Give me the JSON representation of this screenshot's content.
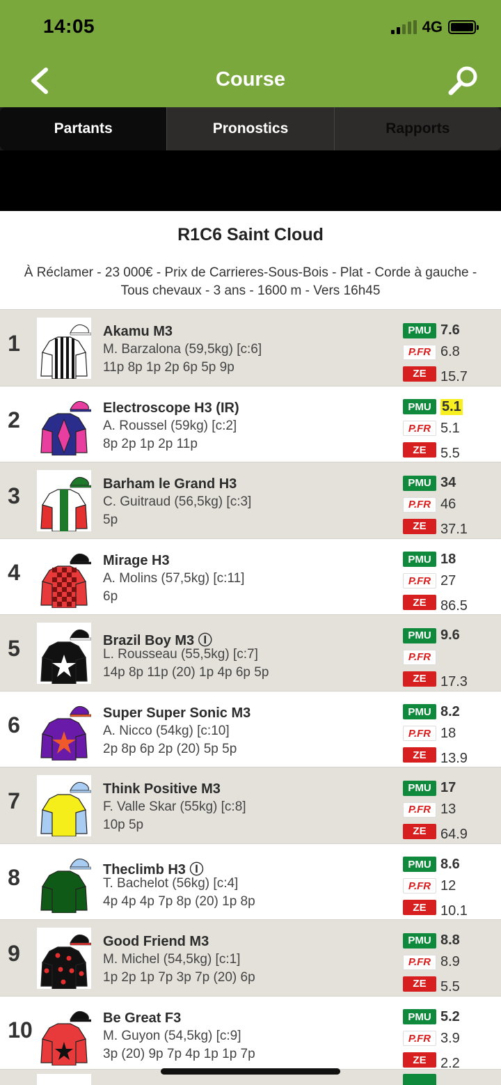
{
  "status": {
    "time": "14:05",
    "network": "4G"
  },
  "nav": {
    "title": "Course",
    "back_icon": "chevron-left-icon",
    "search_icon": "search-icon"
  },
  "tabs": [
    {
      "label": "Partants",
      "active": true
    },
    {
      "label": "Pronostics",
      "active": false
    },
    {
      "label": "Rapports",
      "active": false
    }
  ],
  "race": {
    "title": "R1C6 Saint Cloud",
    "info_line1": "À Réclamer - 23 000€ - Prix de Carrieres-Sous-Bois - Plat - Corde à gauche -",
    "info_line2": "Tous chevaux - 3 ans - 1600 m - Vers 16h45"
  },
  "badges": {
    "pmu": "PMU",
    "pfr": "P.FR",
    "ze": "ZE"
  },
  "colors": {
    "header_green": "#7aa83c",
    "pmu_green": "#0f8a3c",
    "ze_red": "#d71f1f",
    "highlight": "#f7ef1f"
  },
  "runners": [
    {
      "number": "1",
      "name": "Akamu M3",
      "jockey": "M. Barzalona (59,5kg) [c:6]",
      "form": "11p 8p 1p 2p 6p 5p 9p",
      "pmu": "7.6",
      "pfr": "6.8",
      "ze": "15.7",
      "highlight": false,
      "silk": "white-black-stripes"
    },
    {
      "number": "2",
      "name": "Electroscope H3 (IR)",
      "jockey": "A. Roussel (59kg) [c:2]",
      "form": "8p 2p 1p 2p 11p",
      "pmu": "5.1",
      "pfr": "5.1",
      "ze": "5.5",
      "highlight": true,
      "silk": "navy-pink-diamond"
    },
    {
      "number": "3",
      "name": "Barham le Grand H3",
      "jockey": "C. Guitraud (56,5kg) [c:3]",
      "form": "5p",
      "pmu": "34",
      "pfr": "46",
      "ze": "37.1",
      "highlight": false,
      "silk": "white-green-red-sleeves"
    },
    {
      "number": "4",
      "name": "Mirage H3",
      "jockey": "A. Molins (57,5kg) [c:11]",
      "form": "6p",
      "pmu": "18",
      "pfr": "27",
      "ze": "86.5",
      "highlight": false,
      "silk": "red-checks"
    },
    {
      "number": "5",
      "name": "Brazil Boy M3 Ⓘ",
      "jockey": "L. Rousseau (55,5kg) [c:7]",
      "form": "14p 8p 11p (20) 1p 4p 6p 5p",
      "pmu": "9.6",
      "pfr": "",
      "ze": "17.3",
      "highlight": false,
      "silk": "black-white-star"
    },
    {
      "number": "6",
      "name": "Super Super Sonic M3",
      "jockey": "A. Nicco (54kg) [c:10]",
      "form": "2p 8p 6p 2p (20) 5p 5p",
      "pmu": "8.2",
      "pfr": "18",
      "ze": "13.9",
      "highlight": false,
      "silk": "purple-orange-star"
    },
    {
      "number": "7",
      "name": "Think Positive M3",
      "jockey": "F. Valle Skar (55kg) [c:8]",
      "form": "10p 5p",
      "pmu": "17",
      "pfr": "13",
      "ze": "64.9",
      "highlight": false,
      "silk": "yellow-lightblue-sleeves"
    },
    {
      "number": "8",
      "name": "Theclimb H3 Ⓘ",
      "jockey": "T. Bachelot (56kg) [c:4]",
      "form": "4p 4p 4p 7p 8p (20) 1p 8p",
      "pmu": "8.6",
      "pfr": "12",
      "ze": "10.1",
      "highlight": false,
      "silk": "dark-green"
    },
    {
      "number": "9",
      "name": "Good Friend M3",
      "jockey": "M. Michel (54,5kg) [c:1]",
      "form": "1p 2p 1p 7p 3p 7p (20) 6p",
      "pmu": "8.8",
      "pfr": "8.9",
      "ze": "5.5",
      "highlight": false,
      "silk": "black-red-stars"
    },
    {
      "number": "10",
      "name": "Be Great F3",
      "jockey": "M. Guyon (54,5kg) [c:9]",
      "form": "3p (20) 9p 7p 4p 1p 1p 7p",
      "pmu": "5.2",
      "pfr": "3.9",
      "ze": "2.2",
      "highlight": false,
      "silk": "red-black-star"
    }
  ]
}
